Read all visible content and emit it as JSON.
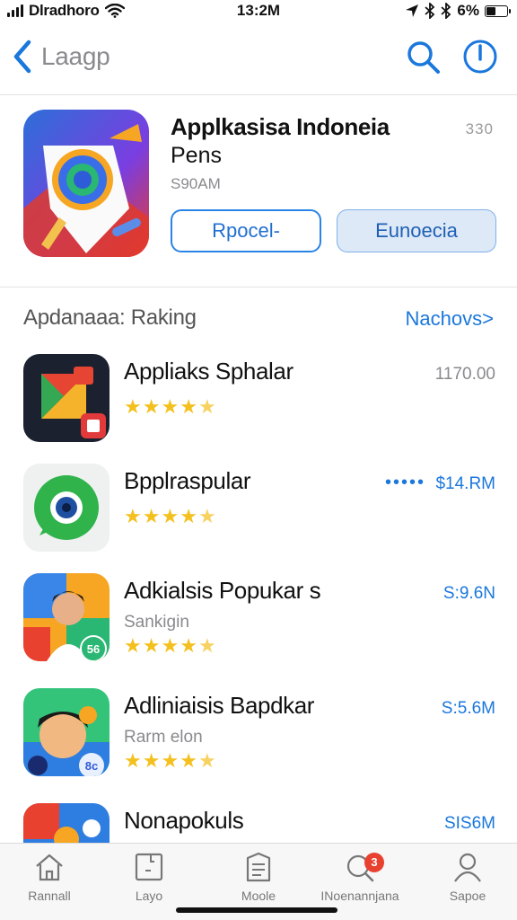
{
  "status_bar": {
    "carrier": "Dlradhoro",
    "time": "13:2M",
    "battery": "6%",
    "icons": [
      "signal-icon",
      "wifi-icon",
      "location-icon",
      "bluetooth-icon",
      "bluetooth-icon",
      "battery-icon"
    ]
  },
  "nav": {
    "back_title": "Laagp",
    "icons": [
      "chevron-left-icon",
      "search-icon",
      "info-icon"
    ],
    "accent": "#1a77dc"
  },
  "featured": {
    "title": "Applkasisa Indoneia",
    "subtitle": "Pens",
    "meta": "S90AM",
    "count": "330",
    "primary_button": "Rpocel-",
    "secondary_button": "Eunoecia"
  },
  "section": {
    "title": "Apdanaaa: Raking",
    "link": "Nachovs>"
  },
  "apps": [
    {
      "name": "Appliaks Sphalar",
      "subtitle": "",
      "rating": 4.5,
      "price": "1170.00"
    },
    {
      "name": "Bpplraspular",
      "subtitle": "",
      "rating": 4.5,
      "price": "$14.RM",
      "dots": "•••••"
    },
    {
      "name": "Adkialsis Popukar s",
      "subtitle": "Sankigin",
      "rating": 4.5,
      "price": "S:9.6N"
    },
    {
      "name": "Adliniaisis Bapdkar",
      "subtitle": "Rarm elon",
      "rating": 4.5,
      "price": "S:5.6M"
    },
    {
      "name": "Nonapokuls",
      "subtitle": "",
      "rating": 0,
      "price": "SIS6M"
    }
  ],
  "tabs": [
    {
      "label": "Rannall",
      "icon": "home-icon"
    },
    {
      "label": "Layo",
      "icon": "document-icon"
    },
    {
      "label": "Moole",
      "icon": "note-icon"
    },
    {
      "label": "INoenannjana",
      "icon": "chat-search-icon",
      "badge": "3"
    },
    {
      "label": "Sapoe",
      "icon": "person-icon"
    }
  ]
}
